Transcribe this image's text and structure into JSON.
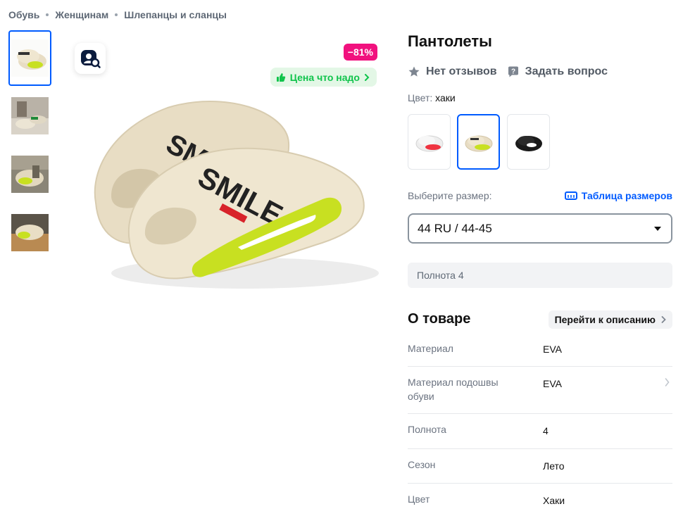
{
  "breadcrumb": [
    "Обувь",
    "Женщинам",
    "Шлепанцы и сланцы"
  ],
  "product": {
    "title": "Пантолеты",
    "reviews": "Нет отзывов",
    "ask": "Задать вопрос",
    "color_label": "Цвет:",
    "color_value": "хаки",
    "discount": "−81%",
    "price_tag": "Цена что надо",
    "size_label": "Выберите размер:",
    "size_table": "Таблица размеров",
    "size_selected": "44 RU / 44-45",
    "fullness": "Полнота 4"
  },
  "colors": {
    "accent": "#005bff",
    "discount": "#f1117e",
    "green": "#10c44c",
    "lime": "#c8e021",
    "khaki": "#e8ddc4"
  },
  "about": {
    "title": "О товаре",
    "goto": "Перейти к описанию",
    "specs": [
      {
        "k": "Материал",
        "v": "EVA"
      },
      {
        "k": "Материал подошвы обуви",
        "v": "EVA"
      },
      {
        "k": "Полнота",
        "v": "4"
      },
      {
        "k": "Сезон",
        "v": "Лето"
      },
      {
        "k": "Цвет",
        "v": "Хаки"
      }
    ]
  }
}
